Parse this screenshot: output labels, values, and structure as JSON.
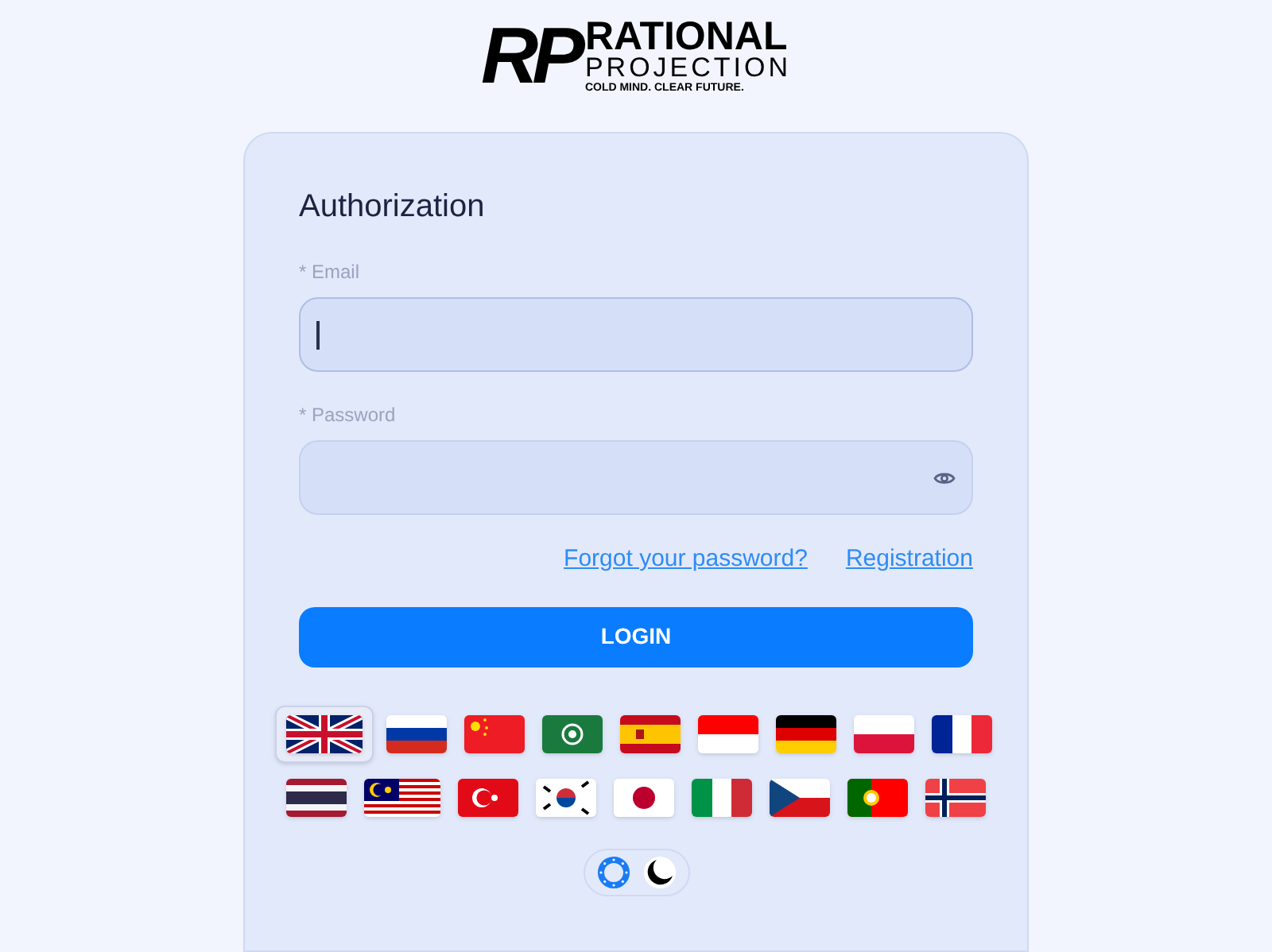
{
  "logo": {
    "mark": "RP",
    "name": "RATIONAL",
    "subname": "PROJECTION",
    "tagline": "COLD MIND. CLEAR FUTURE."
  },
  "form": {
    "title": "Authorization",
    "fields": [
      {
        "label": "* Email",
        "kind": "text",
        "focused": true
      },
      {
        "label": "* Password",
        "kind": "password",
        "focused": false
      }
    ],
    "links": [
      "Forgot your password?",
      "Registration"
    ],
    "submit": "LOGIN"
  },
  "languages": [
    [
      {
        "kind": "gb",
        "selected": true
      },
      {
        "kind": "ru",
        "selected": false
      },
      {
        "kind": "cn",
        "selected": false
      },
      {
        "kind": "sa",
        "selected": false
      },
      {
        "kind": "es",
        "selected": false
      },
      {
        "kind": "id",
        "selected": false
      },
      {
        "kind": "de",
        "selected": false
      },
      {
        "kind": "pl",
        "selected": false
      },
      {
        "kind": "fr",
        "selected": false
      }
    ],
    [
      {
        "kind": "th",
        "selected": false
      },
      {
        "kind": "my",
        "selected": false
      },
      {
        "kind": "tr",
        "selected": false
      },
      {
        "kind": "kr",
        "selected": false
      },
      {
        "kind": "jp",
        "selected": false
      },
      {
        "kind": "it",
        "selected": false
      },
      {
        "kind": "cz",
        "selected": false
      },
      {
        "kind": "pt",
        "selected": false
      },
      {
        "kind": "no",
        "selected": false
      }
    ]
  ],
  "theme_options": [
    {
      "kind": "light",
      "selected": true
    },
    {
      "kind": "dark",
      "selected": false
    }
  ]
}
